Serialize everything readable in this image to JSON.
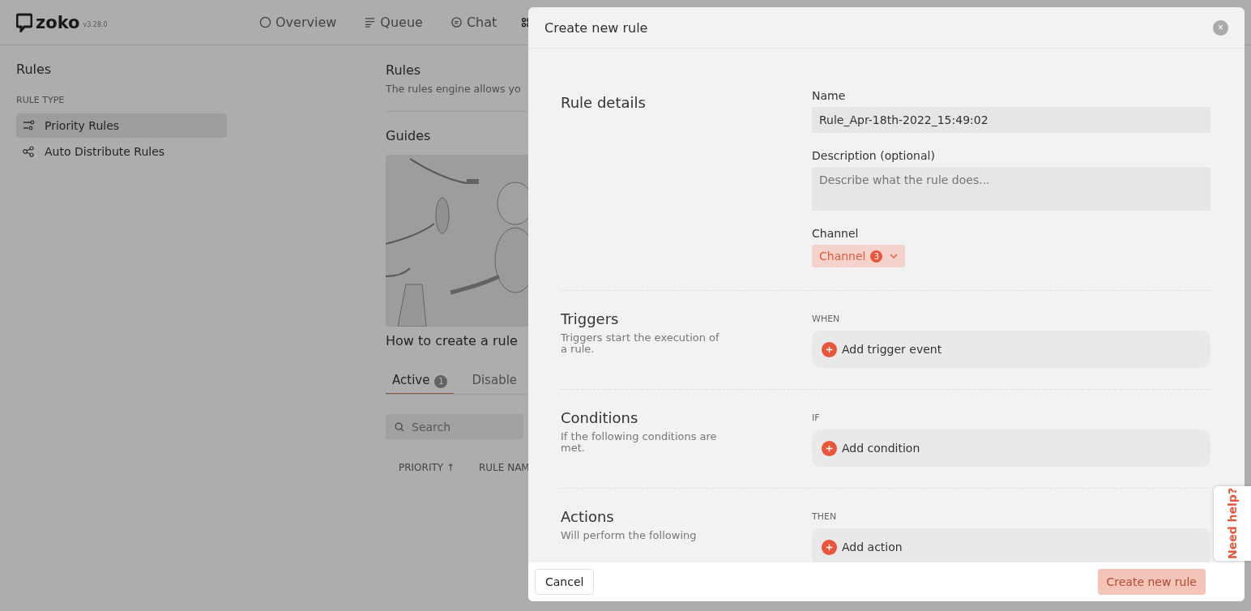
{
  "app": {
    "logo": "zoko",
    "version": "v3.28.0",
    "nav": [
      {
        "label": "Overview"
      },
      {
        "label": "Queue"
      },
      {
        "label": "Chat"
      }
    ]
  },
  "sidebar": {
    "title": "Rules",
    "section": "RULE TYPE",
    "items": [
      {
        "label": "Priority Rules",
        "selected": true
      },
      {
        "label": "Auto Distribute Rules",
        "selected": false
      }
    ]
  },
  "main": {
    "title": "Rules",
    "subtitle": "The rules engine allows yo",
    "guides_title": "Guides",
    "guide": {
      "kind": "picture",
      "caption": "How to create a rule"
    },
    "tabs": [
      {
        "label": "Active",
        "count": "1",
        "selected": true
      },
      {
        "label": "Disable",
        "selected": false
      }
    ],
    "search": {
      "placeholder": "Search"
    },
    "columns": [
      "PRIORITY ↑",
      "RULE NAM"
    ]
  },
  "modal": {
    "title": "Create new rule",
    "close": "×",
    "details": {
      "title": "Rule details",
      "name_label": "Name",
      "name_value": "Rule_Apr-18th-2022_15:49:02",
      "description_label": "Description (optional)",
      "description_placeholder": "Describe what the rule does...",
      "channel_label": "Channel",
      "channel_button": "Channel",
      "channel_count": "3"
    },
    "sections": [
      {
        "title": "Triggers",
        "description": "Triggers start the execution of a rule.",
        "keyword": "WHEN",
        "add": "Add trigger event"
      },
      {
        "title": "Conditions",
        "description": "If the following conditions are met.",
        "keyword": "IF",
        "add": "Add condition"
      },
      {
        "title": "Actions",
        "description": "Will perform the following",
        "keyword": "THEN",
        "add": "Add action"
      }
    ],
    "cancel": "Cancel",
    "submit": {
      "label": "Create new rule",
      "disabled": true
    }
  },
  "help": "Need help?"
}
